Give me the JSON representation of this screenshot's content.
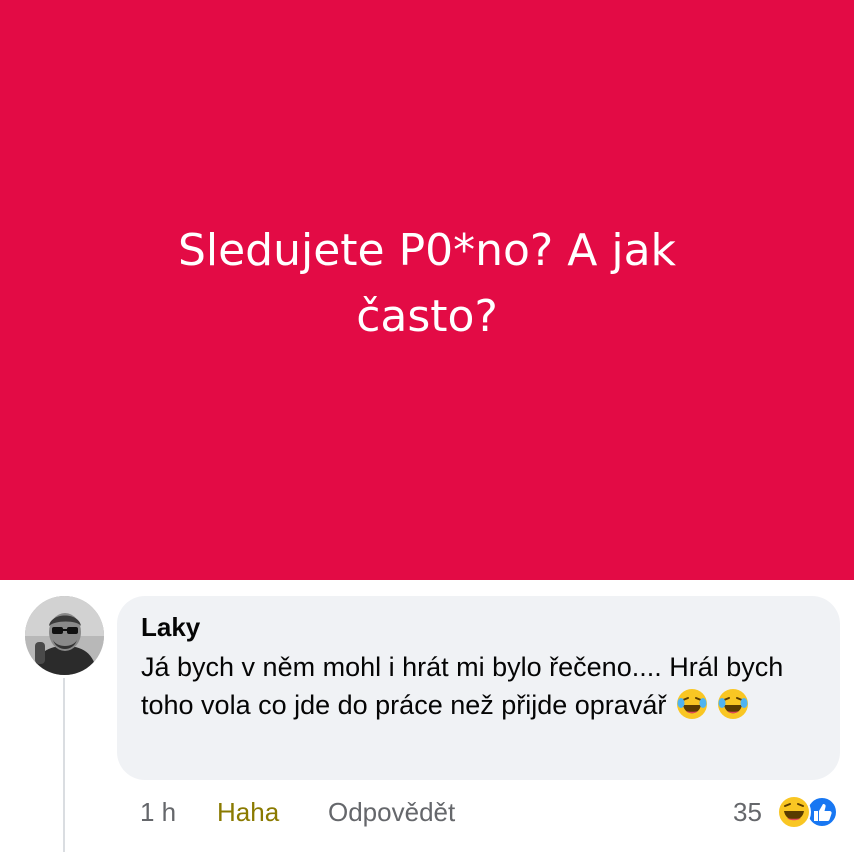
{
  "post": {
    "text": "Sledujete P0*no? A jak často?",
    "background_color": "#e30b45"
  },
  "comment": {
    "author": "Laky",
    "text": "Já bych v něm mohl i hrát mi bylo řečeno.... Hrál bych toho vola co jde do práce než přijde opravář",
    "emoji": [
      "laughing-tears-emoji",
      "laughing-tears-emoji"
    ],
    "avatar_icon": "user-avatar-photo"
  },
  "actions": {
    "time": "1 h",
    "reaction_label": "Haha",
    "reply_label": "Odpovědět"
  },
  "reactions": {
    "count": "35",
    "icons": [
      "haha-reaction-icon",
      "like-reaction-icon"
    ]
  }
}
